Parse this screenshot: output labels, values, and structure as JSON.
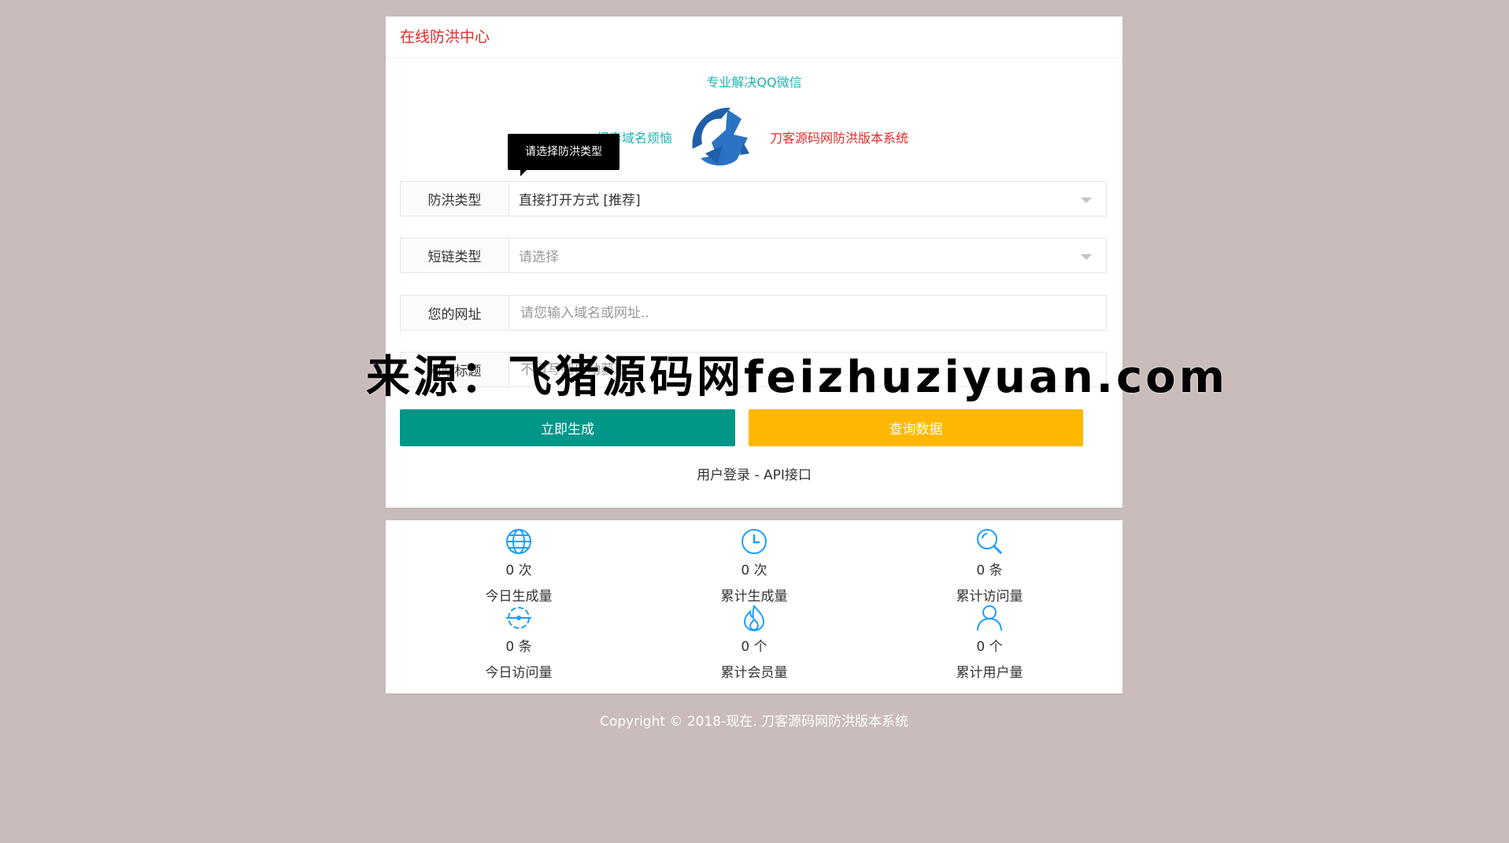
{
  "header": {
    "title": "在线防洪中心"
  },
  "brand": {
    "tagline_top": "专业解决QQ微信",
    "tagline_left": "报毒域名烦恼",
    "tagline_right": "刀客源码网防洪版本系统"
  },
  "tooltip": {
    "text": "请选择防洪类型"
  },
  "form": {
    "rows": [
      {
        "label": "防洪类型",
        "value": "直接打开方式 [推荐]"
      },
      {
        "label": "短链类型",
        "placeholder": "请选择"
      },
      {
        "label": "您的网址",
        "placeholder": "请您输入域名或网址.."
      },
      {
        "label": "网站标题",
        "placeholder": "不填写则自动获取"
      }
    ]
  },
  "buttons": {
    "generate": "立即生成",
    "query": "查询数据"
  },
  "links": {
    "login": "用户登录",
    "separator": " - ",
    "api": "API接口"
  },
  "stats": [
    {
      "icon": "globe-icon",
      "value": "0 次",
      "label": "今日生成量"
    },
    {
      "icon": "clock-icon",
      "value": "0 次",
      "label": "累计生成量"
    },
    {
      "icon": "search-icon",
      "value": "0 条",
      "label": "累计访问量"
    },
    {
      "icon": "loading-icon",
      "value": "0 条",
      "label": "今日访问量"
    },
    {
      "icon": "fire-icon",
      "value": "0 个",
      "label": "累计会员量"
    },
    {
      "icon": "user-icon",
      "value": "0 个",
      "label": "累计用户量"
    }
  ],
  "footer": {
    "copyright": "Copyright © 2018-现在. 刀客源码网防洪版本系统"
  },
  "watermark": {
    "text": "来源：飞猪源码网feizhuziyuan.com"
  },
  "colors": {
    "background": "#c9bcba",
    "title_red": "#e12b2b",
    "teal": "#1fb3b3",
    "button_green": "#009688",
    "button_yellow": "#ffb800",
    "icon_blue": "#1e9fff"
  }
}
